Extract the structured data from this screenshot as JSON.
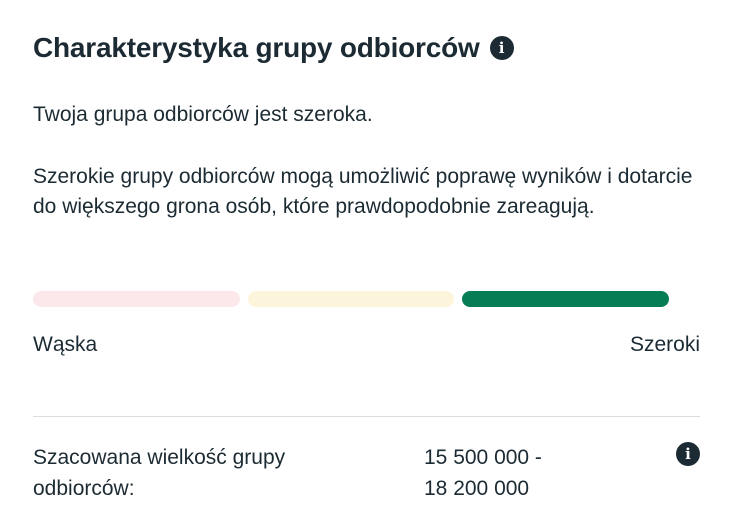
{
  "header": {
    "title": "Charakterystyka grupy odbiorców",
    "info_icon": "info-icon"
  },
  "audience": {
    "status_text": "Twoja grupa odbiorców jest szeroka.",
    "description": "Szerokie grupy odbiorców mogą umożliwić poprawę wyników i dotarcie do większego grona osób, które prawdopodobnie zareagują."
  },
  "meter": {
    "level": "broad",
    "active_segment": 3,
    "segment_count": 3,
    "segment_colors": [
      "#fce8ea",
      "#fdf4dc",
      "#077d55"
    ],
    "left_label": "Wąska",
    "right_label": "Szeroki"
  },
  "estimate": {
    "label": "Szacowana wielkość grupy odbiorców:",
    "value_min": "15 500 000 -",
    "value_max": "18 200 000",
    "info_icon": "info-icon"
  }
}
